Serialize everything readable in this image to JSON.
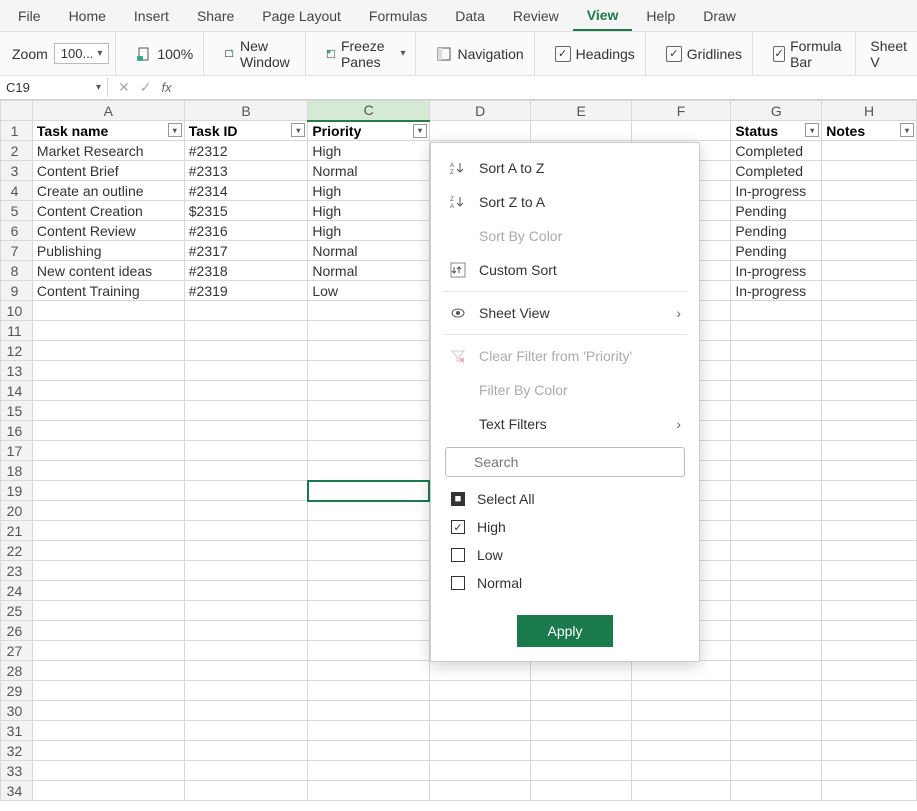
{
  "menubar": [
    "File",
    "Home",
    "Insert",
    "Share",
    "Page Layout",
    "Formulas",
    "Data",
    "Review",
    "View",
    "Help",
    "Draw"
  ],
  "menubar_active_index": 8,
  "ribbon": {
    "zoom_label": "Zoom",
    "zoom_value": "100...",
    "zoom_100": "100%",
    "new_window": "New Window",
    "freeze_panes": "Freeze Panes",
    "navigation": "Navigation",
    "headings": "Headings",
    "gridlines": "Gridlines",
    "formula_bar": "Formula Bar",
    "sheet_v": "Sheet V"
  },
  "namebox": "C19",
  "columns": [
    "A",
    "B",
    "C",
    "D",
    "E",
    "F",
    "G",
    "H"
  ],
  "col_classes": [
    "col-A",
    "col-B",
    "col-C",
    "col-D",
    "col-E",
    "col-F",
    "col-G",
    "col-H"
  ],
  "headers": {
    "A": "Task name",
    "B": "Task ID",
    "C": "Priority",
    "G": "Status",
    "H": "Notes"
  },
  "rows": [
    {
      "A": "Market Research",
      "B": "#2312",
      "C": "High",
      "G": "Completed"
    },
    {
      "A": "Content Brief",
      "B": "#2313",
      "C": "Normal",
      "G": "Completed"
    },
    {
      "A": "Create an outline",
      "B": "#2314",
      "C": "High",
      "G": "In-progress"
    },
    {
      "A": "Content Creation",
      "B": "$2315",
      "C": "High",
      "G": "Pending"
    },
    {
      "A": "Content Review",
      "B": "#2316",
      "C": "High",
      "G": "Pending"
    },
    {
      "A": "Publishing",
      "B": "#2317",
      "C": "Normal",
      "G": "Pending"
    },
    {
      "A": "New content ideas",
      "B": "#2318",
      "C": "Normal",
      "G": "In-progress"
    },
    {
      "A": "Content Training",
      "B": "#2319",
      "C": "Low",
      "G": "In-progress"
    }
  ],
  "total_rows": 34,
  "active_cell": {
    "row": 19,
    "col": "C"
  },
  "filter_menu": {
    "sort_az": "Sort A to Z",
    "sort_za": "Sort Z to A",
    "sort_color": "Sort By Color",
    "custom_sort": "Custom Sort",
    "sheet_view": "Sheet View",
    "clear_filter": "Clear Filter from 'Priority'",
    "filter_color": "Filter By Color",
    "text_filters": "Text Filters",
    "search_placeholder": "Search",
    "select_all": "Select All",
    "options": [
      {
        "label": "High",
        "checked": true
      },
      {
        "label": "Low",
        "checked": false
      },
      {
        "label": "Normal",
        "checked": false
      }
    ],
    "apply": "Apply"
  }
}
